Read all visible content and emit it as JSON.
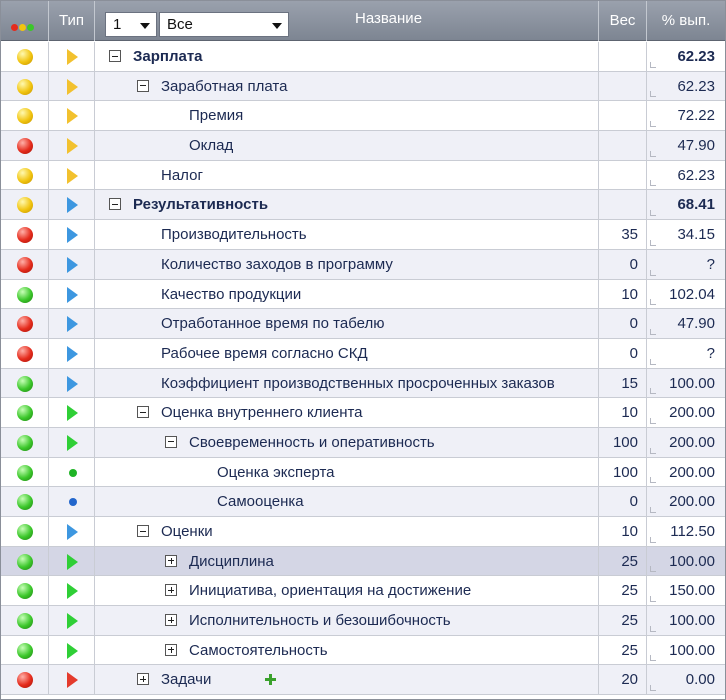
{
  "header": {
    "type_label": "Тип",
    "name_label": "Название",
    "weight_label": "Вес",
    "pct_label": "% вып.",
    "level_value": "1",
    "filter_value": "Все"
  },
  "colors": {
    "yellow": "#f1c40f",
    "red": "#e52b1c",
    "green": "#3bc72a",
    "blue": "#3d97e0"
  },
  "rows": [
    {
      "status": "yellow",
      "type": "triangle-yellow",
      "level": 0,
      "toggle": "minus",
      "name": "Зарплата",
      "bold": true,
      "weight": "",
      "pct": "62.23"
    },
    {
      "status": "yellow",
      "type": "triangle-yellow",
      "level": 1,
      "toggle": "minus",
      "name": "Заработная плата",
      "bold": false,
      "weight": "",
      "pct": "62.23"
    },
    {
      "status": "yellow",
      "type": "triangle-yellow",
      "level": 2,
      "toggle": "",
      "name": "Премия",
      "bold": false,
      "weight": "",
      "pct": "72.22"
    },
    {
      "status": "red",
      "type": "triangle-yellow",
      "level": 2,
      "toggle": "",
      "name": "Оклад",
      "bold": false,
      "weight": "",
      "pct": "47.90"
    },
    {
      "status": "yellow",
      "type": "triangle-yellow",
      "level": 1,
      "toggle": "",
      "name": "Налог",
      "bold": false,
      "weight": "",
      "pct": "62.23"
    },
    {
      "status": "yellow",
      "type": "triangle-blue",
      "level": 0,
      "toggle": "minus",
      "name": "Результативность",
      "bold": true,
      "weight": "",
      "pct": "68.41"
    },
    {
      "status": "red",
      "type": "triangle-blue",
      "level": 1,
      "toggle": "",
      "name": "Производительность",
      "bold": false,
      "weight": "35",
      "pct": "34.15"
    },
    {
      "status": "red",
      "type": "triangle-blue",
      "level": 1,
      "toggle": "",
      "name": "Количество заходов в программу",
      "bold": false,
      "weight": "0",
      "pct": "?"
    },
    {
      "status": "green",
      "type": "triangle-blue",
      "level": 1,
      "toggle": "",
      "name": "Качество продукции",
      "bold": false,
      "weight": "10",
      "pct": "102.04"
    },
    {
      "status": "red",
      "type": "triangle-blue",
      "level": 1,
      "toggle": "",
      "name": "Отработанное время по табелю",
      "bold": false,
      "weight": "0",
      "pct": "47.90"
    },
    {
      "status": "red",
      "type": "triangle-blue",
      "level": 1,
      "toggle": "",
      "name": "Рабочее время согласно СКД",
      "bold": false,
      "weight": "0",
      "pct": "?"
    },
    {
      "status": "green",
      "type": "triangle-blue",
      "level": 1,
      "toggle": "",
      "name": "Коэффициент производственных просроченных заказов",
      "bold": false,
      "weight": "15",
      "pct": "100.00"
    },
    {
      "status": "green",
      "type": "triangle-green",
      "level": 1,
      "toggle": "minus",
      "name": "Оценка внутреннего клиента",
      "bold": false,
      "weight": "10",
      "pct": "200.00"
    },
    {
      "status": "green",
      "type": "triangle-green",
      "level": 2,
      "toggle": "minus",
      "name": "Своевременность и оперативность",
      "bold": false,
      "weight": "100",
      "pct": "200.00"
    },
    {
      "status": "green",
      "type": "dot-green",
      "level": 3,
      "toggle": "",
      "name": "Оценка эксперта",
      "bold": false,
      "weight": "100",
      "pct": "200.00"
    },
    {
      "status": "green",
      "type": "dot-blue",
      "level": 3,
      "toggle": "",
      "name": "Самооценка",
      "bold": false,
      "weight": "0",
      "pct": "200.00"
    },
    {
      "status": "green",
      "type": "triangle-blue",
      "level": 1,
      "toggle": "minus",
      "name": "Оценки",
      "bold": false,
      "weight": "10",
      "pct": "112.50"
    },
    {
      "status": "green",
      "type": "triangle-green",
      "level": 2,
      "toggle": "plus",
      "name": "Дисциплина",
      "bold": false,
      "weight": "25",
      "pct": "100.00"
    },
    {
      "status": "green",
      "type": "triangle-green",
      "level": 2,
      "toggle": "plus",
      "name": "Инициатива, ориентация на достижение",
      "bold": false,
      "weight": "25",
      "pct": "150.00"
    },
    {
      "status": "green",
      "type": "triangle-green",
      "level": 2,
      "toggle": "plus",
      "name": "Исполнительность и безошибочность",
      "bold": false,
      "weight": "25",
      "pct": "100.00"
    },
    {
      "status": "green",
      "type": "triangle-green",
      "level": 2,
      "toggle": "plus",
      "name": "Самостоятельность",
      "bold": false,
      "weight": "25",
      "pct": "100.00"
    },
    {
      "status": "red",
      "type": "triangle-red",
      "level": 1,
      "toggle": "plus",
      "name": "Задачи",
      "bold": false,
      "weight": "20",
      "pct": "0.00",
      "add": true
    }
  ]
}
